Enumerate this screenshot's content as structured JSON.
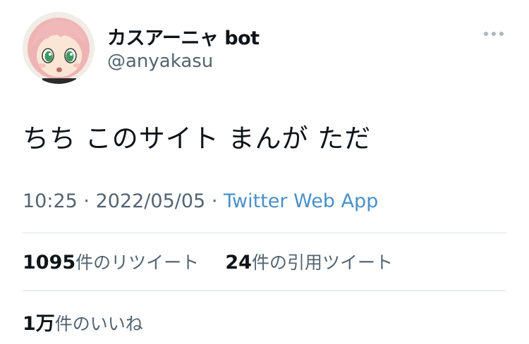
{
  "tweet": {
    "author_name": "カスアーニャ bot",
    "handle": "@anyakasu",
    "text": "ちち このサイト まんが ただ",
    "time": "10:25",
    "date": "2022/05/05",
    "separator": "·",
    "source": "Twitter Web App"
  },
  "stats": {
    "retweets_count": "1095",
    "retweets_label": "件のリツイート",
    "quotes_count": "24",
    "quotes_label": "件の引用ツイート",
    "likes_count": "1万",
    "likes_label": "件のいいね"
  },
  "colors": {
    "text": "#0f1419",
    "secondary": "#536471",
    "link": "#4a90c8",
    "divider": "#dadfe3"
  },
  "icons": {
    "more": "more-options-icon",
    "avatar": "anime-character-avatar"
  }
}
